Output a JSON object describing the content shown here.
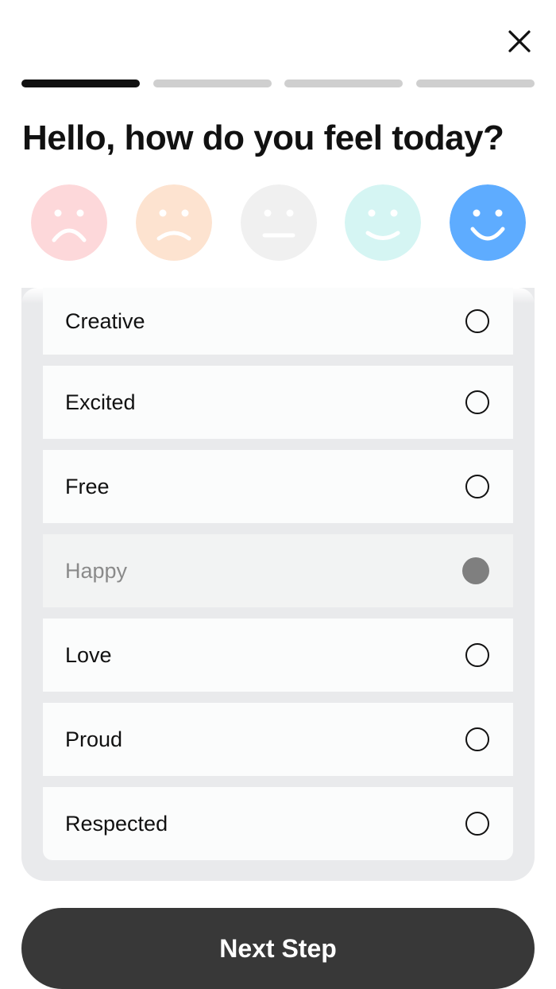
{
  "header": {
    "close_icon": "close-icon",
    "progress": {
      "total_steps": 4,
      "current_step": 1
    },
    "title": "Hello, how do you feel today?"
  },
  "moods": [
    {
      "icon": "very-sad-face-icon",
      "color": "#fdd8da",
      "selected": false
    },
    {
      "icon": "sad-face-icon",
      "color": "#fde3d0",
      "selected": false
    },
    {
      "icon": "neutral-face-icon",
      "color": "#f0f0f0",
      "selected": false
    },
    {
      "icon": "happy-face-icon",
      "color": "#d5f5f3",
      "selected": false
    },
    {
      "icon": "very-happy-face-icon",
      "color": "#5eacff",
      "selected": true
    }
  ],
  "options": [
    {
      "label": "Creative",
      "selected": false
    },
    {
      "label": "Excited",
      "selected": false
    },
    {
      "label": "Free",
      "selected": false
    },
    {
      "label": "Happy",
      "selected": true
    },
    {
      "label": "Love",
      "selected": false
    },
    {
      "label": "Proud",
      "selected": false
    },
    {
      "label": "Respected",
      "selected": false
    }
  ],
  "footer": {
    "next_label": "Next Step",
    "button_color": "#383838"
  }
}
